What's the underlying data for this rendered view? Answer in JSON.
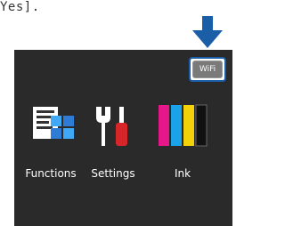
{
  "document": {
    "caption_fragment": "Yes]."
  },
  "pointer_arrow_icon": "down-arrow-icon",
  "screen": {
    "status_button": {
      "label": "WiFi",
      "highlight_color": "#1a5ea8"
    },
    "menu": [
      {
        "label": "Functions",
        "icon": "functions-icon"
      },
      {
        "label": "Settings",
        "icon": "settings-icon"
      },
      {
        "label": "Ink",
        "icon": "ink-icon"
      }
    ]
  },
  "colors": {
    "screen_background": "#2a2a2a",
    "arrow": "#1a5ea8"
  }
}
